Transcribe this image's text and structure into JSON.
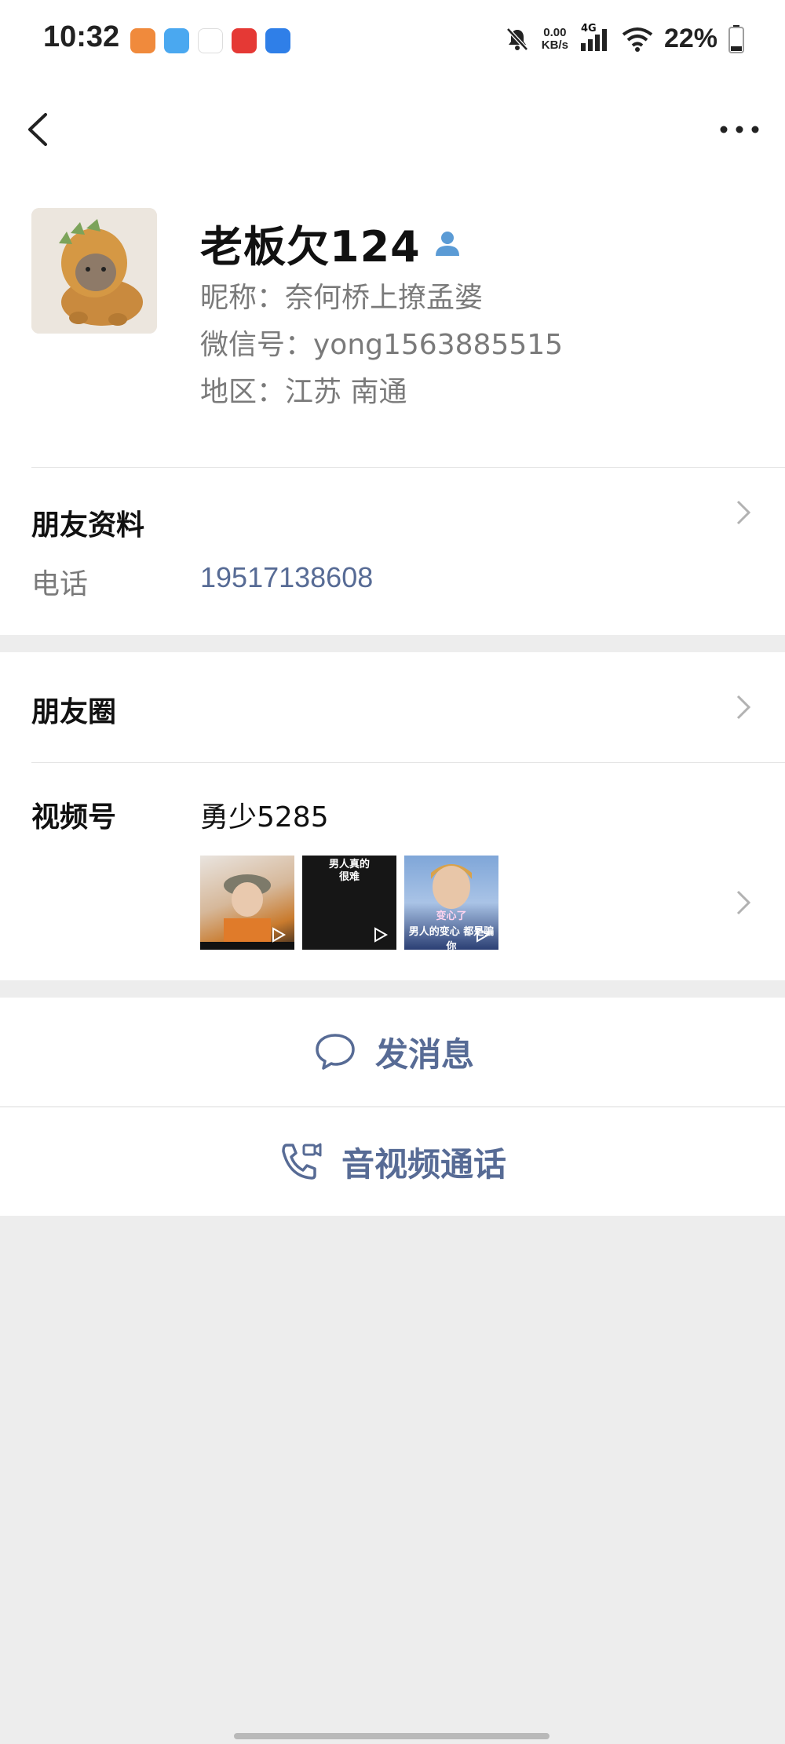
{
  "status_bar": {
    "time": "10:32",
    "speed_value": "0.00",
    "speed_unit": "KB/s",
    "network": "4G",
    "battery": "22%"
  },
  "profile": {
    "display_name": "老板欠124",
    "nickname": "昵称：奈何桥上撩孟婆",
    "wechat_id": "微信号：yong1563885515",
    "region": "地区：江苏  南通"
  },
  "friend_info": {
    "title": "朋友资料",
    "phone_label": "电话",
    "phone_value": "19517138608"
  },
  "moments": {
    "title": "朋友圈"
  },
  "channels": {
    "title": "视频号",
    "name": "勇少5285",
    "thumbnails": [
      {
        "caption_top": "",
        "caption_bottom": ""
      },
      {
        "caption_top": "男人真的",
        "caption_bottom": "很难"
      },
      {
        "caption_top": "变心了",
        "caption_bottom": "男人的变心 都是骗你"
      }
    ]
  },
  "actions": {
    "message": "发消息",
    "call": "音视频通话"
  },
  "colors": {
    "link": "#576b95",
    "secondary_text": "#7a7a7a",
    "background": "#ededed"
  }
}
